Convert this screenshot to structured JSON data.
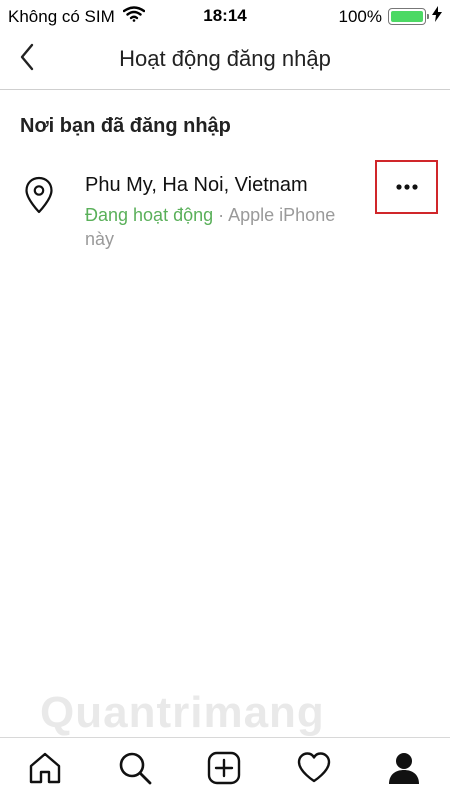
{
  "status_bar": {
    "carrier": "Không có SIM",
    "time": "18:14",
    "battery_text": "100%",
    "battery_level": 1.0,
    "battery_color": "#4cd964"
  },
  "nav": {
    "title": "Hoạt động đăng nhập",
    "back_icon": "chevron-left-icon"
  },
  "section": {
    "title": "Nơi bạn đã đăng nhập"
  },
  "login_items": [
    {
      "location": "Phu My, Ha Noi, Vietnam",
      "status_active": "Đang hoạt động",
      "separator": " · ",
      "device": "Apple iPhone này",
      "icon": "map-pin-icon",
      "more_icon": "more-dots-icon"
    }
  ],
  "tab_bar": {
    "tabs": [
      "home-icon",
      "search-icon",
      "add-post-icon",
      "heart-icon",
      "profile-icon"
    ]
  },
  "watermark": {
    "text": "Quantrimang"
  },
  "colors": {
    "active_green": "#5ab05a",
    "highlight_red": "#d0262a"
  }
}
